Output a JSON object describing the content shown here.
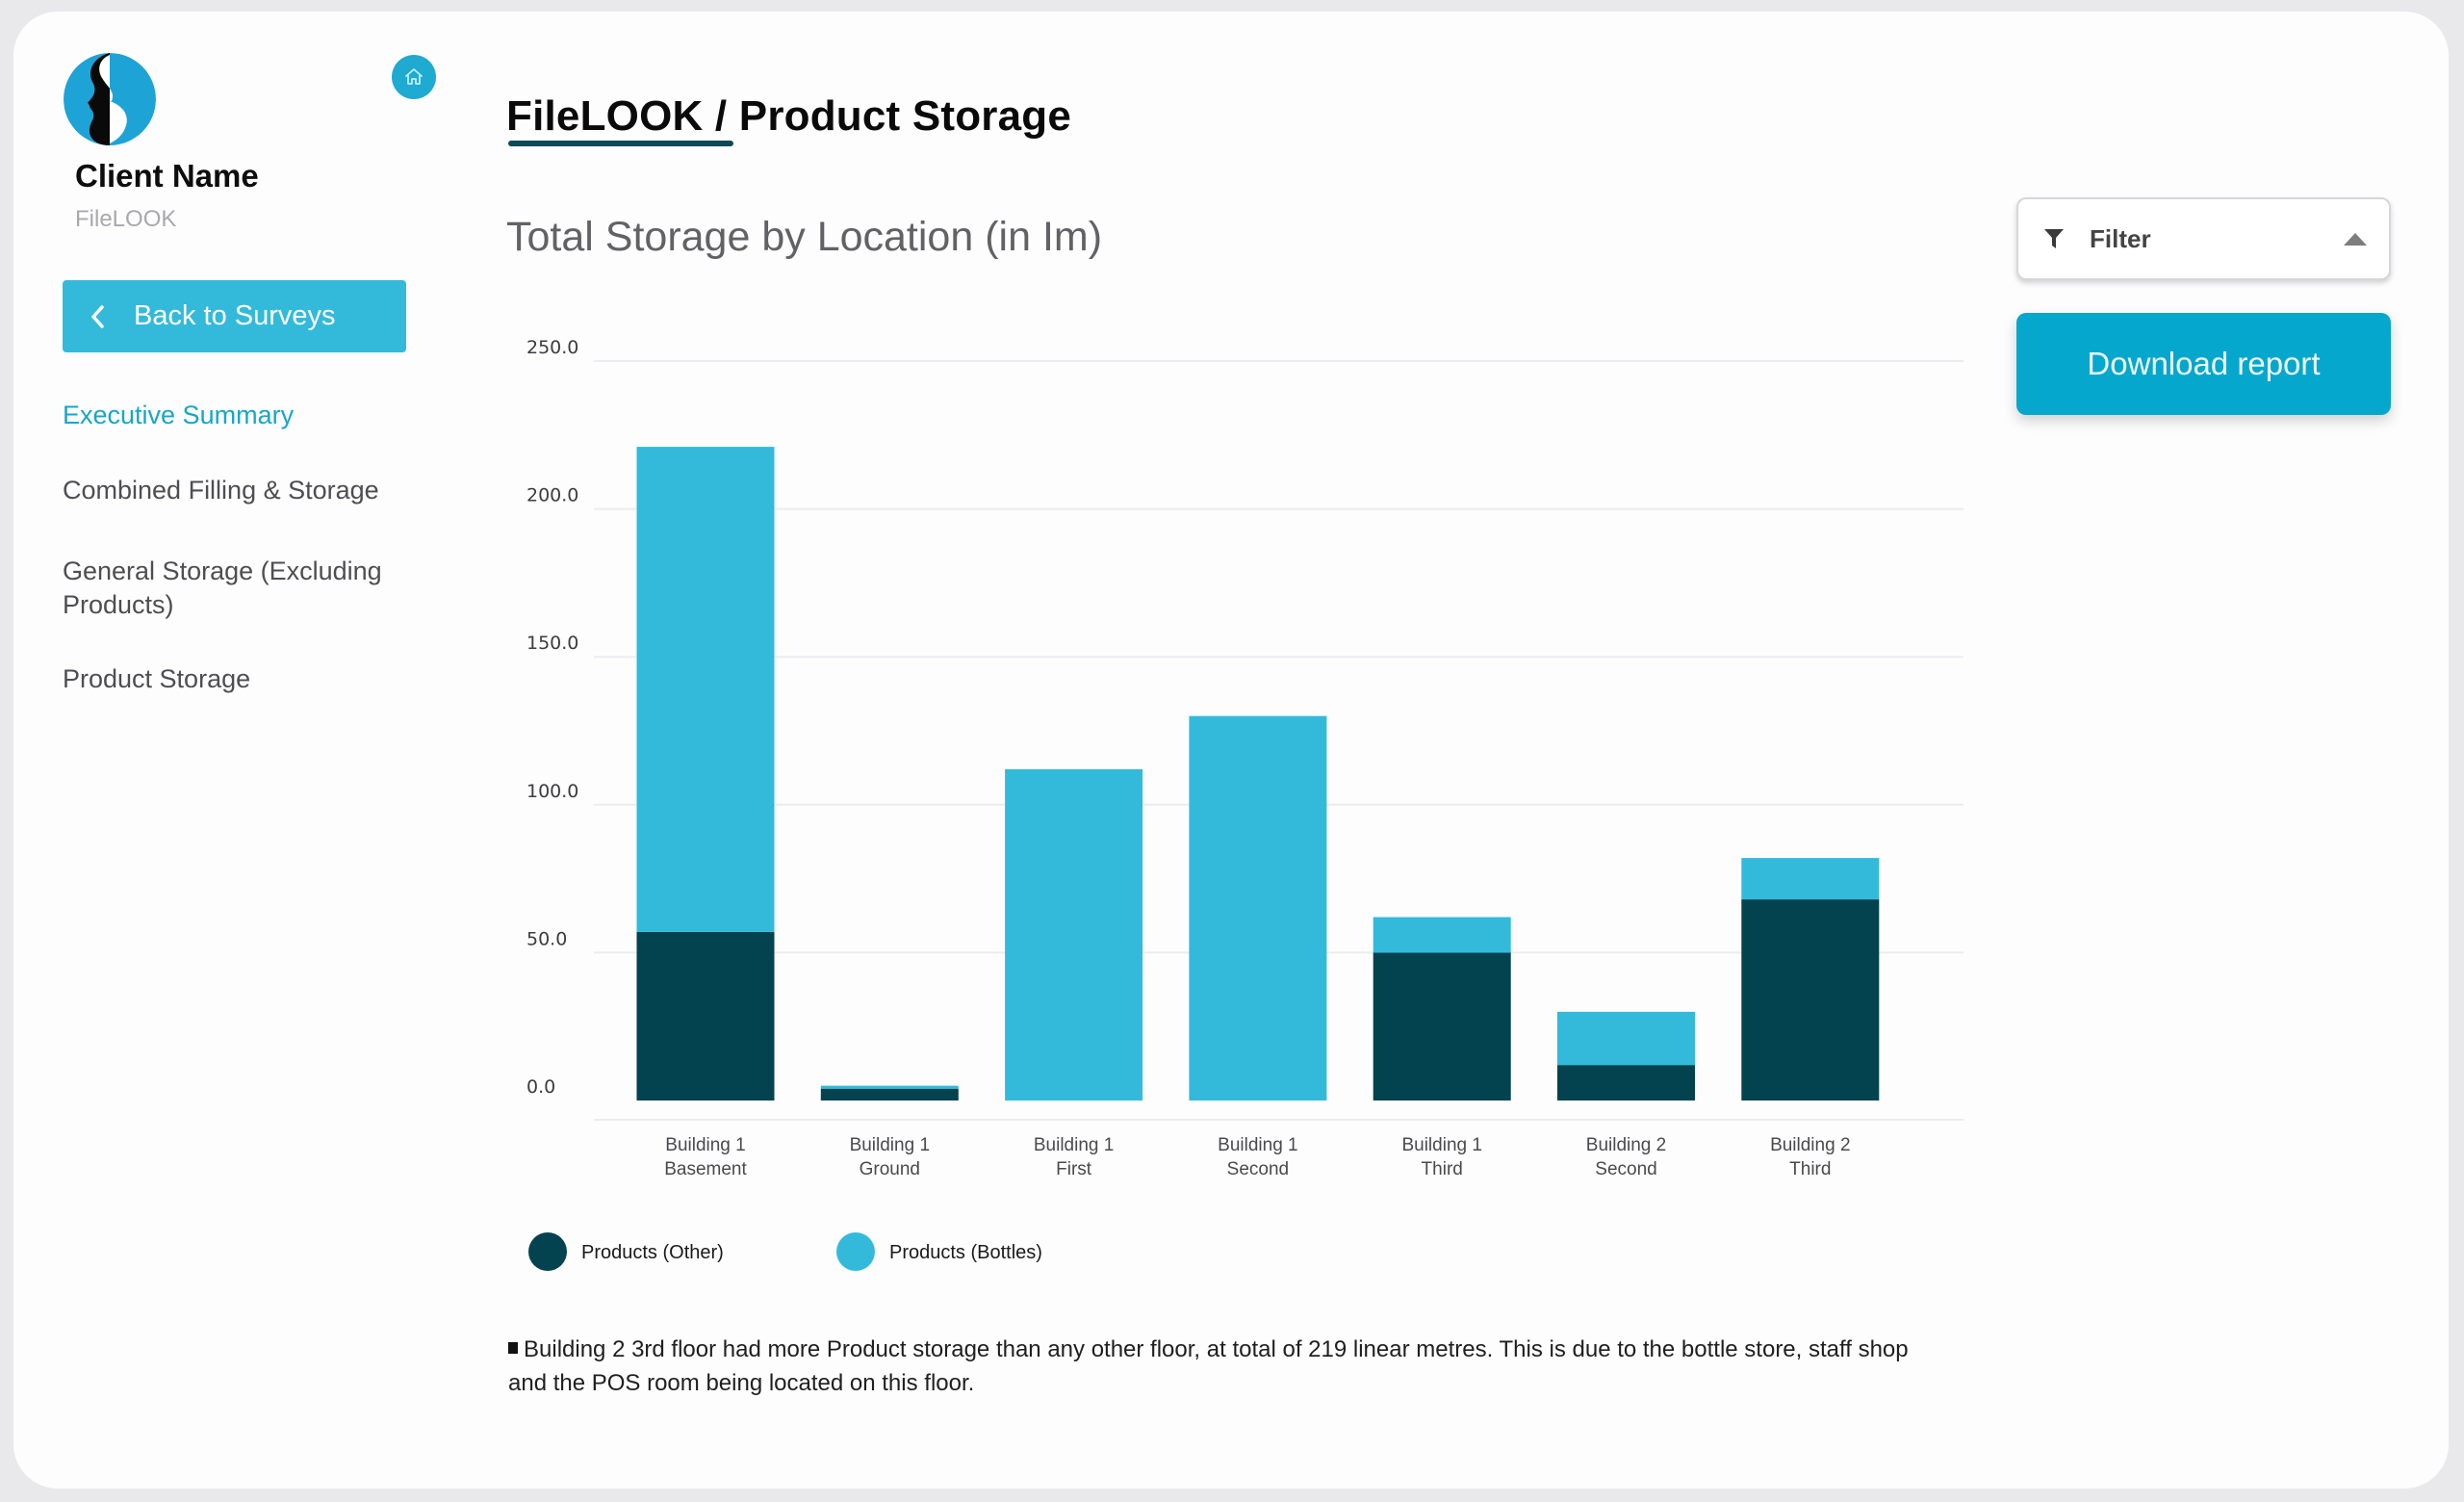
{
  "sidebar": {
    "client_name": "Client Name",
    "client_sub": "FileLOOK",
    "back_label": "Back to Surveys",
    "nav": [
      {
        "label": "Executive Summary",
        "active": true
      },
      {
        "label": "Combined Filling & Storage",
        "active": false
      },
      {
        "label": "General Storage (Excluding Products)",
        "active": false
      },
      {
        "label": "Product Storage",
        "active": false
      }
    ],
    "icons": {
      "logo": "client-logo",
      "home": "home-icon",
      "back": "chevron-left-icon"
    }
  },
  "header": {
    "title": "FileLOOK / Product Storage"
  },
  "controls": {
    "filter_label": "Filter",
    "download_label": "Download report"
  },
  "colors": {
    "accent": "#33bada",
    "download": "#06a7cd",
    "series_other": "#03434f",
    "series_bottles": "#33badb",
    "active_nav": "#17a7c4"
  },
  "chart_data": {
    "type": "bar",
    "stacked": true,
    "title": "Total Storage by Location (in lm)",
    "title_display": "Total Storage by Location (in Im)",
    "xlabel": "",
    "ylabel": "",
    "ylim": [
      0,
      250
    ],
    "yticks": [
      0,
      50,
      100,
      150,
      200,
      250
    ],
    "ytick_labels": [
      "0.0",
      "50.0",
      "100.0",
      "150.0",
      "200.0",
      "250.0"
    ],
    "grid": true,
    "legend_position": "bottom-left",
    "categories": [
      [
        "Building 1",
        "Basement"
      ],
      [
        "Building 1",
        "Ground"
      ],
      [
        "Building 1",
        "First"
      ],
      [
        "Building 1",
        "Second"
      ],
      [
        "Building 1",
        "Third"
      ],
      [
        "Building 2",
        "Second"
      ],
      [
        "Building 2",
        "Third"
      ]
    ],
    "series": [
      {
        "name": "Products (Other)",
        "color": "#03434f",
        "values": [
          57,
          4,
          0,
          0,
          50,
          12,
          68
        ]
      },
      {
        "name": "Products (Bottles)",
        "color": "#33badb",
        "values": [
          164,
          1,
          112,
          130,
          12,
          18,
          14
        ]
      }
    ]
  },
  "note": {
    "text": "Building 2 3rd floor had more Product storage than any other floor, at total of 219 linear metres. This is due to the bottle store, staff shop and the POS room being located on this floor."
  }
}
